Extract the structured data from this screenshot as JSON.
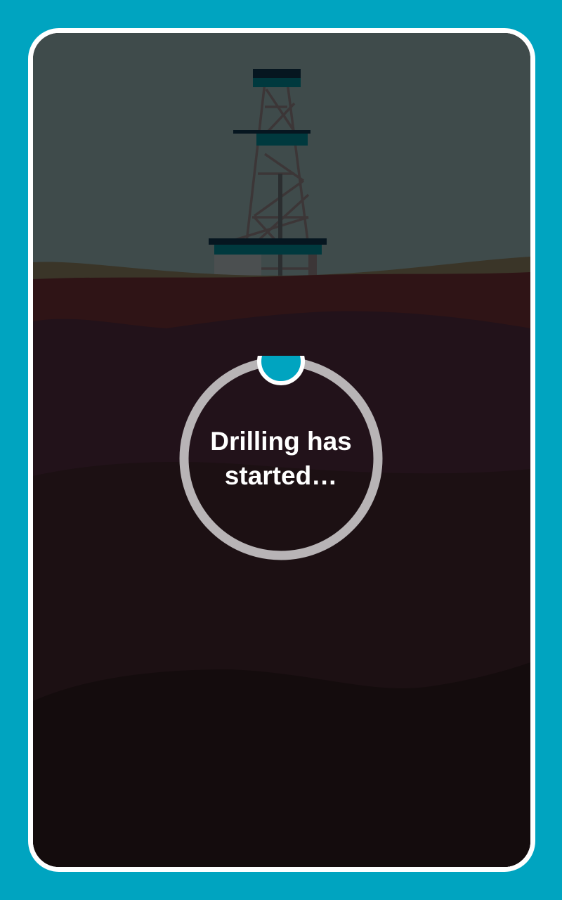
{
  "loading": {
    "message": "Drilling has\nstarted…",
    "progress": 0
  },
  "colors": {
    "background": "#00a4c0",
    "card_border": "#ffffff",
    "sky": "#3f4b4b",
    "ground_surface": "#3a3528",
    "soil_top": "#2f1416",
    "soil_deep": "#140c0d",
    "ring_track": "#b8b4b6",
    "ring_knob": "#00a4c0",
    "text": "#ffffff"
  },
  "icons": {
    "rig": "drilling-rig-icon",
    "knob": "progress-knob-icon"
  }
}
